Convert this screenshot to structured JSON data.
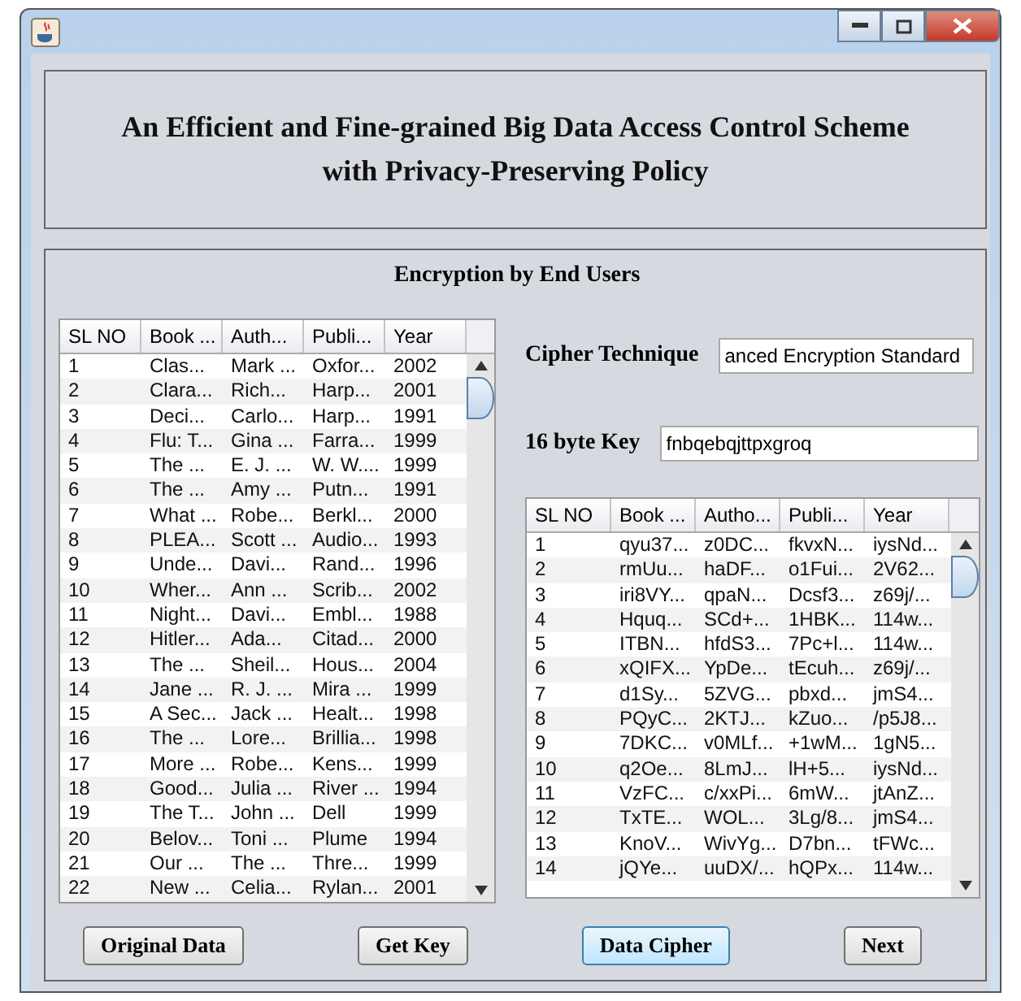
{
  "window": {
    "title_lines": [
      "An Efficient and Fine-grained Big Data Access Control Scheme",
      "with Privacy-Preserving Policy"
    ]
  },
  "section_title": "Encryption by End Users",
  "original_table": {
    "columns": [
      "SL NO",
      "Book ...",
      "Auth...",
      "Publi...",
      "Year"
    ],
    "rows": [
      [
        "1",
        "Clas...",
        "Mark ...",
        "Oxfor...",
        "2002"
      ],
      [
        "2",
        "Clara...",
        "Rich...",
        "Harp...",
        "2001"
      ],
      [
        "3",
        "Deci...",
        "Carlo...",
        "Harp...",
        "1991"
      ],
      [
        "4",
        "Flu: T...",
        "Gina ...",
        "Farra...",
        "1999"
      ],
      [
        "5",
        "The ...",
        "E. J. ...",
        "W. W....",
        "1999"
      ],
      [
        "6",
        "The ...",
        "Amy ...",
        "Putn...",
        "1991"
      ],
      [
        "7",
        "What ...",
        "Robe...",
        "Berkl...",
        "2000"
      ],
      [
        "8",
        "PLEA...",
        "Scott ...",
        "Audio...",
        "1993"
      ],
      [
        "9",
        "Unde...",
        "Davi...",
        "Rand...",
        "1996"
      ],
      [
        "10",
        "Wher...",
        "Ann ...",
        "Scrib...",
        "2002"
      ],
      [
        "11",
        "Night...",
        "Davi...",
        "Embl...",
        "1988"
      ],
      [
        "12",
        "Hitler...",
        "Ada...",
        "Citad...",
        "2000"
      ],
      [
        "13",
        "The ...",
        "Sheil...",
        "Hous...",
        "2004"
      ],
      [
        "14",
        "Jane ...",
        "R. J. ...",
        "Mira ...",
        "1999"
      ],
      [
        "15",
        "A Sec...",
        "Jack ...",
        "Healt...",
        "1998"
      ],
      [
        "16",
        "The ...",
        "Lore...",
        "Brillia...",
        "1998"
      ],
      [
        "17",
        "More ...",
        "Robe...",
        "Kens...",
        "1999"
      ],
      [
        "18",
        "Good...",
        "Julia ...",
        "River ...",
        "1994"
      ],
      [
        "19",
        "The T...",
        "John ...",
        "Dell",
        "1999"
      ],
      [
        "20",
        "Belov...",
        "Toni ...",
        "Plume",
        "1994"
      ],
      [
        "21",
        "Our ...",
        "The ...",
        "Thre...",
        "1999"
      ],
      [
        "22",
        "New ...",
        "Celia...",
        "Rylan...",
        "2001"
      ]
    ]
  },
  "cipher_technique": {
    "label": "Cipher Technique",
    "value": "anced Encryption Standard"
  },
  "key": {
    "label": "16 byte Key",
    "value": "fnbqebqjttpxgroq"
  },
  "cipher_table": {
    "columns": [
      "SL NO",
      "Book ...",
      "Autho...",
      "Publi...",
      "Year"
    ],
    "rows": [
      [
        "1",
        "qyu37...",
        "z0DC...",
        "fkvxN...",
        "iysNd..."
      ],
      [
        "2",
        "rmUu...",
        "haDF...",
        "o1Fui...",
        "2V62..."
      ],
      [
        "3",
        "iri8VY...",
        "qpaN...",
        "Dcsf3...",
        "z69j/..."
      ],
      [
        "4",
        "Hquq...",
        "SCd+...",
        "1HBK...",
        "114w..."
      ],
      [
        "5",
        "ITBN...",
        "hfdS3...",
        "7Pc+l...",
        "114w..."
      ],
      [
        "6",
        "xQIFX...",
        "YpDe...",
        "tEcuh...",
        "z69j/..."
      ],
      [
        "7",
        "d1Sy...",
        "5ZVG...",
        "pbxd...",
        "jmS4..."
      ],
      [
        "8",
        "PQyC...",
        "2KTJ...",
        "kZuo...",
        "/p5J8..."
      ],
      [
        "9",
        "7DKC...",
        "v0MLf...",
        "+1wM...",
        "1gN5..."
      ],
      [
        "10",
        "q2Oe...",
        "8LmJ...",
        "lH+5...",
        "iysNd..."
      ],
      [
        "11",
        "VzFC...",
        "c/xxPi...",
        "6mW...",
        "jtAnZ..."
      ],
      [
        "12",
        "TxTE...",
        "WOL...",
        "3Lg/8...",
        "jmS4..."
      ],
      [
        "13",
        "KnoV...",
        "WivYg...",
        "D7bn...",
        "tFWc..."
      ],
      [
        "14",
        "jQYe...",
        "uuDX/...",
        "hQPx...",
        "114w..."
      ]
    ]
  },
  "buttons": [
    {
      "label": "Original Data",
      "focused": false
    },
    {
      "label": "Get Key",
      "focused": false
    },
    {
      "label": "Data Cipher",
      "focused": true
    },
    {
      "label": "Next",
      "focused": false
    }
  ]
}
